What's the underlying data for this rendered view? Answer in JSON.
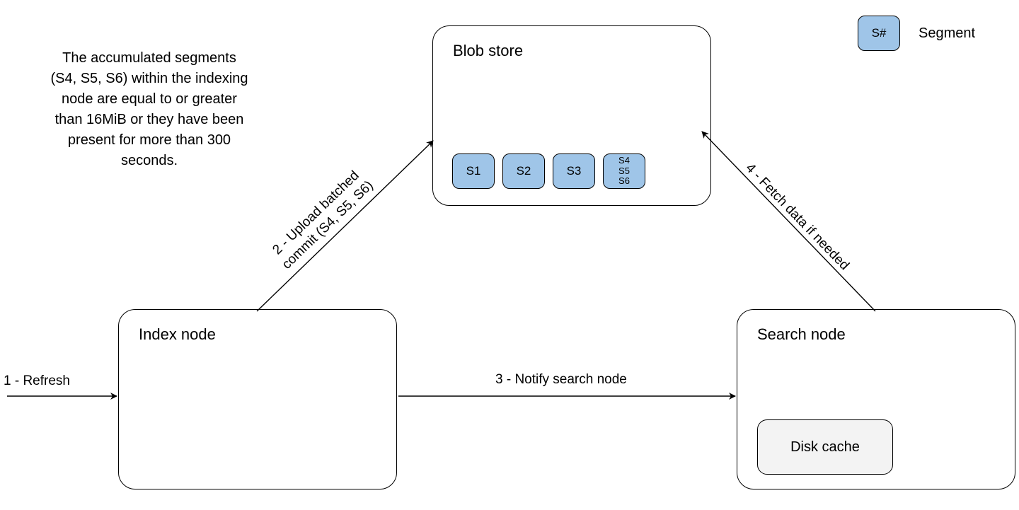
{
  "explain_text": "The accumulated segments (S4, S5, S6) within the indexing node are equal to or greater than 16MiB or they have been present for more than 300 seconds.",
  "index_node": {
    "title": "Index node"
  },
  "blob_store": {
    "title": "Blob store",
    "segments": {
      "s1": "S1",
      "s2": "S2",
      "s3": "S3",
      "s4_line1": "S4",
      "s4_line2": "S5",
      "s4_line3": "S6"
    }
  },
  "search_node": {
    "title": "Search node",
    "disk_cache": "Disk cache"
  },
  "legend": {
    "symbol": "S#",
    "label": "Segment"
  },
  "edges": {
    "refresh": "1 - Refresh",
    "upload_l1": "2 - Upload batched",
    "upload_l2": "commit (S4, S5, S6)",
    "notify": "3 - Notify search node",
    "fetch": "4 - Fetch data if needed"
  }
}
